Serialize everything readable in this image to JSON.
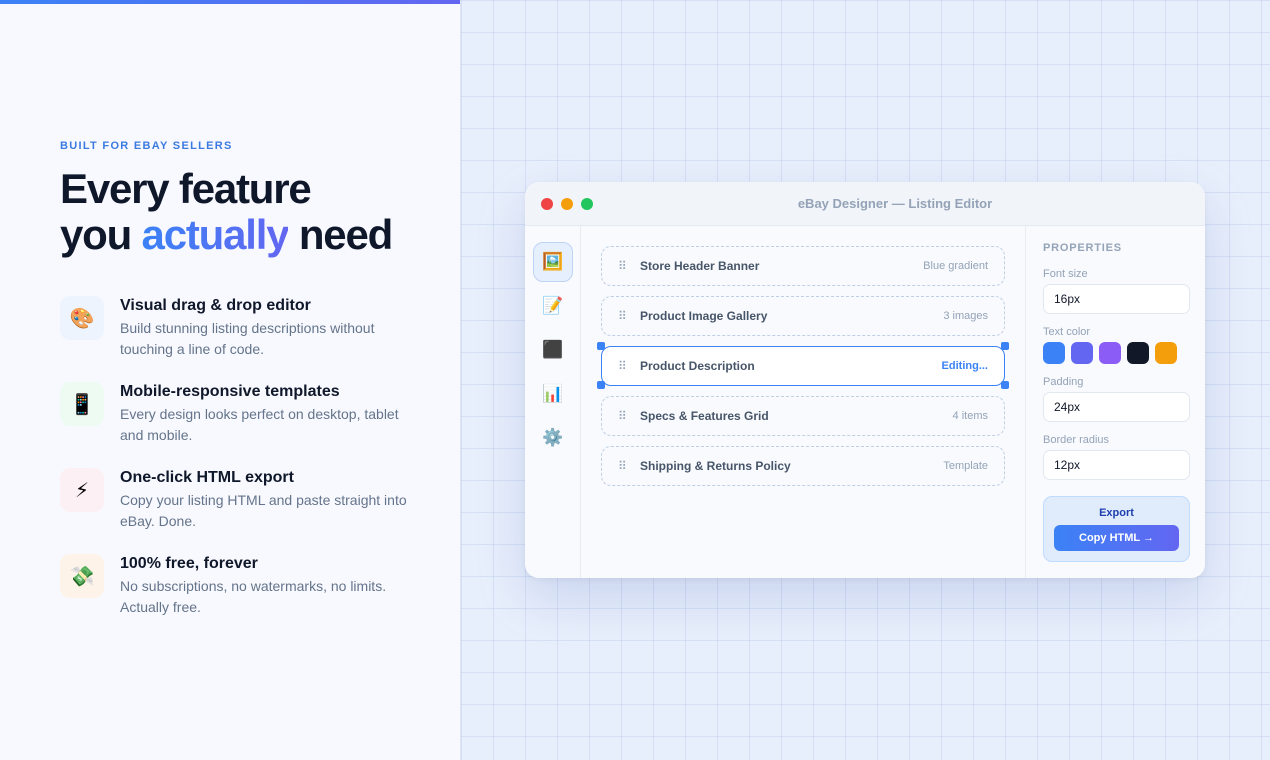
{
  "hero": {
    "eyebrow": "BUILT FOR EBAY SELLERS",
    "headline_line1": "Every feature",
    "headline_pre": "you ",
    "headline_highlight": "actually",
    "headline_post": " need"
  },
  "features": [
    {
      "icon": "palette-icon",
      "glyph": "🎨",
      "bg": "#eef4fe",
      "title": "Visual drag & drop editor",
      "desc": "Build stunning listing descriptions without touching a line of code."
    },
    {
      "icon": "mobile-phone-icon",
      "glyph": "📱",
      "bg": "#edfbf3",
      "title": "Mobile-responsive templates",
      "desc": "Every design looks perfect on desktop, tablet and mobile."
    },
    {
      "icon": "lightning-icon",
      "glyph": "⚡",
      "bg": "#fdf0f5",
      "title": "One-click HTML export",
      "desc": "Copy your listing HTML and paste straight into eBay. Done."
    },
    {
      "icon": "money-wings-icon",
      "glyph": "💸",
      "bg": "#fdf3e9",
      "title": "100% free, forever",
      "desc": "No subscriptions, no watermarks, no limits. Actually free."
    }
  ],
  "window": {
    "title": "eBay Designer — Listing Editor",
    "traffic_lights": [
      "#ef4444",
      "#f59e0b",
      "#22c55e"
    ]
  },
  "toolbar": [
    {
      "icon": "image-icon",
      "glyph": "🖼️",
      "active": true
    },
    {
      "icon": "memo-icon",
      "glyph": "📝",
      "active": false
    },
    {
      "icon": "black-square-icon",
      "glyph": "⬛",
      "active": false
    },
    {
      "icon": "bar-chart-icon",
      "glyph": "📊",
      "active": false
    },
    {
      "icon": "gear-icon",
      "glyph": "⚙️",
      "active": false
    }
  ],
  "blocks": [
    {
      "name": "Store Header Banner",
      "meta": "Blue gradient",
      "editing": false
    },
    {
      "name": "Product Image Gallery",
      "meta": "3 images",
      "editing": false
    },
    {
      "name": "Product Description",
      "meta": "Editing...",
      "editing": true
    },
    {
      "name": "Specs & Features Grid",
      "meta": "4 items",
      "editing": false
    },
    {
      "name": "Shipping & Returns Policy",
      "meta": "Template",
      "editing": false
    }
  ],
  "properties": {
    "title": "PROPERTIES",
    "font_size_label": "Font size",
    "font_size_value": "16px",
    "text_color_label": "Text color",
    "swatches": [
      "#3b82f6",
      "#6366f1",
      "#8b5cf6",
      "#111827",
      "#f59e0b"
    ],
    "padding_label": "Padding",
    "padding_value": "24px",
    "radius_label": "Border radius",
    "radius_value": "12px",
    "export_label": "Export",
    "copy_label": "Copy HTML →"
  }
}
